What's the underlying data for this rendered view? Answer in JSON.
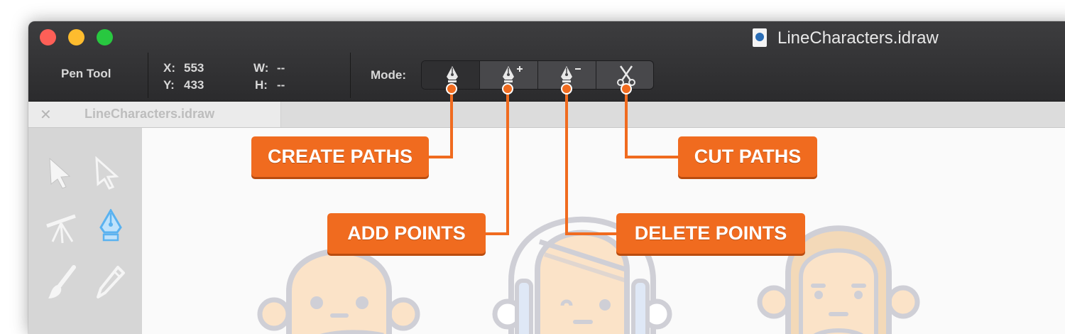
{
  "window": {
    "document_title": "LineCharacters.idraw",
    "app_icon": "idraw-document-icon"
  },
  "toolbar": {
    "tool_name": "Pen Tool",
    "x_label": "X:",
    "x_value": "553",
    "y_label": "Y:",
    "y_value": "433",
    "w_label": "W:",
    "w_value": "--",
    "h_label": "H:",
    "h_value": "--",
    "mode_label": "Mode:",
    "modes": [
      {
        "icon": "pen-nib-icon",
        "active": true
      },
      {
        "icon": "pen-add-point-icon",
        "active": false
      },
      {
        "icon": "pen-delete-point-icon",
        "active": false
      },
      {
        "icon": "scissors-icon",
        "active": false
      }
    ]
  },
  "tab": {
    "label": "LineCharacters.idraw",
    "close_icon": "close-icon"
  },
  "tools": [
    {
      "icon": "selection-arrow-icon"
    },
    {
      "icon": "direct-selection-arrow-icon"
    },
    {
      "icon": "tripod-tool-icon"
    },
    {
      "icon": "pen-tool-icon",
      "active": true
    },
    {
      "icon": "brush-icon"
    },
    {
      "icon": "pencil-icon"
    }
  ],
  "callouts": {
    "create_paths": "CREATE PATHS",
    "add_points": "ADD POINTS",
    "delete_points": "DELETE POINTS",
    "cut_paths": "CUT PATHS"
  },
  "colors": {
    "accent": "#f06b1f",
    "titlebar": "#343436",
    "skin": "#fbe3c8",
    "line": "#cfcfd6",
    "active_tool": "#5ab2f0"
  }
}
